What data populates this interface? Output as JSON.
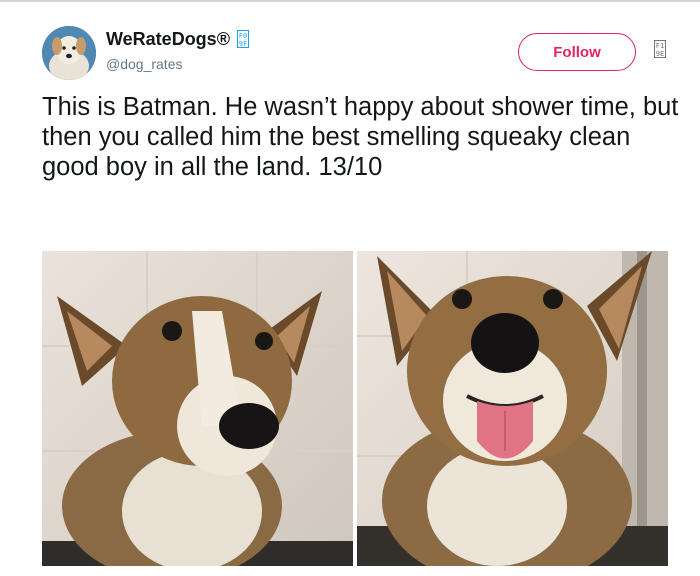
{
  "user": {
    "display_name": "WeRateDogs®",
    "handle": "@dog_rates",
    "name_glyph": "F0\n9F",
    "verified_color": "#1da1f2"
  },
  "follow_button": {
    "label": "Follow",
    "color": "#e0245e"
  },
  "caret_glyph": "F1\n9E",
  "tweet": {
    "text": "This is Batman. He wasn’t happy about shower time, but then you called him the best smelling squeaky clean good boy in all the land. 13/10"
  },
  "media": [
    {
      "subject": "wet corgi looking at camera, head tilted"
    },
    {
      "subject": "wet corgi smiling with tongue out"
    }
  ]
}
